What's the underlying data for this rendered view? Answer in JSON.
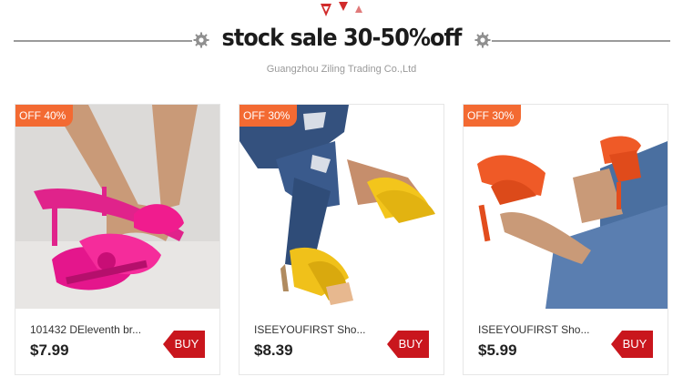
{
  "header": {
    "title": "stock sale 30-50%off",
    "subtitle": "Guangzhou Ziling Trading Co.,Ltd"
  },
  "colors": {
    "badge": "#f36a32",
    "buy_button": "#c9161d",
    "accent_triangles": "#d12b2b"
  },
  "icons": [
    "gear-icon",
    "decorative-triangles"
  ],
  "products": [
    {
      "discount": "OFF 40%",
      "name": "101432 DEleventh br...",
      "price": "$7.99",
      "buy_label": "BUY"
    },
    {
      "discount": "OFF 30%",
      "name": "ISEEYOUFIRST Sho...",
      "price": "$8.39",
      "buy_label": "BUY"
    },
    {
      "discount": "OFF 30%",
      "name": "ISEEYOUFIRST Sho...",
      "price": "$5.99",
      "buy_label": "BUY"
    }
  ]
}
